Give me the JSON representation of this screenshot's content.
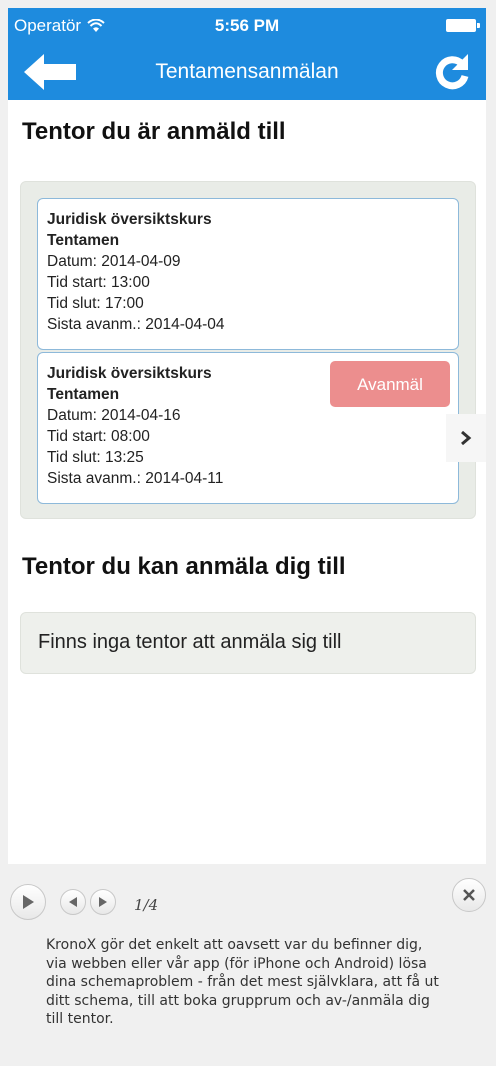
{
  "status_bar": {
    "carrier": "Operatör",
    "time": "5:56 PM"
  },
  "nav": {
    "title": "Tentamensanmälan",
    "back_icon": "arrow-left-icon",
    "refresh_icon": "refresh-icon"
  },
  "registered": {
    "title": "Tentor du är anmäld till",
    "exams": [
      {
        "course": "Juridisk översiktskurs",
        "kind": "Tentamen",
        "date": "Datum: 2014-04-09",
        "start": "Tid start: 13:00",
        "end": "Tid slut: 17:00",
        "deadline": "Sista avanm.: 2014-04-04"
      },
      {
        "course": "Juridisk översiktskurs",
        "kind": "Tentamen",
        "date": "Datum: 2014-04-16",
        "start": "Tid start: 08:00",
        "end": "Tid slut: 13:25",
        "deadline": "Sista avanm.: 2014-04-11",
        "action": "Avanmäl"
      }
    ]
  },
  "available": {
    "title": "Tentor du kan anmäla dig till",
    "empty_text": "Finns inga tentor att anmäla sig till"
  },
  "player": {
    "counter": "1/4",
    "caption": "KronoX gör det enkelt att oavsett var du befinner dig, via webben eller vår app (för iPhone och Android) lösa dina schemaproblem - från det mest självklara, att få ut ditt schema, till att boka grupprum och av-/anmäla dig till tentor."
  },
  "colors": {
    "accent": "#1e8bde",
    "danger": "#ec8e8e",
    "card_border": "#8db9da"
  }
}
